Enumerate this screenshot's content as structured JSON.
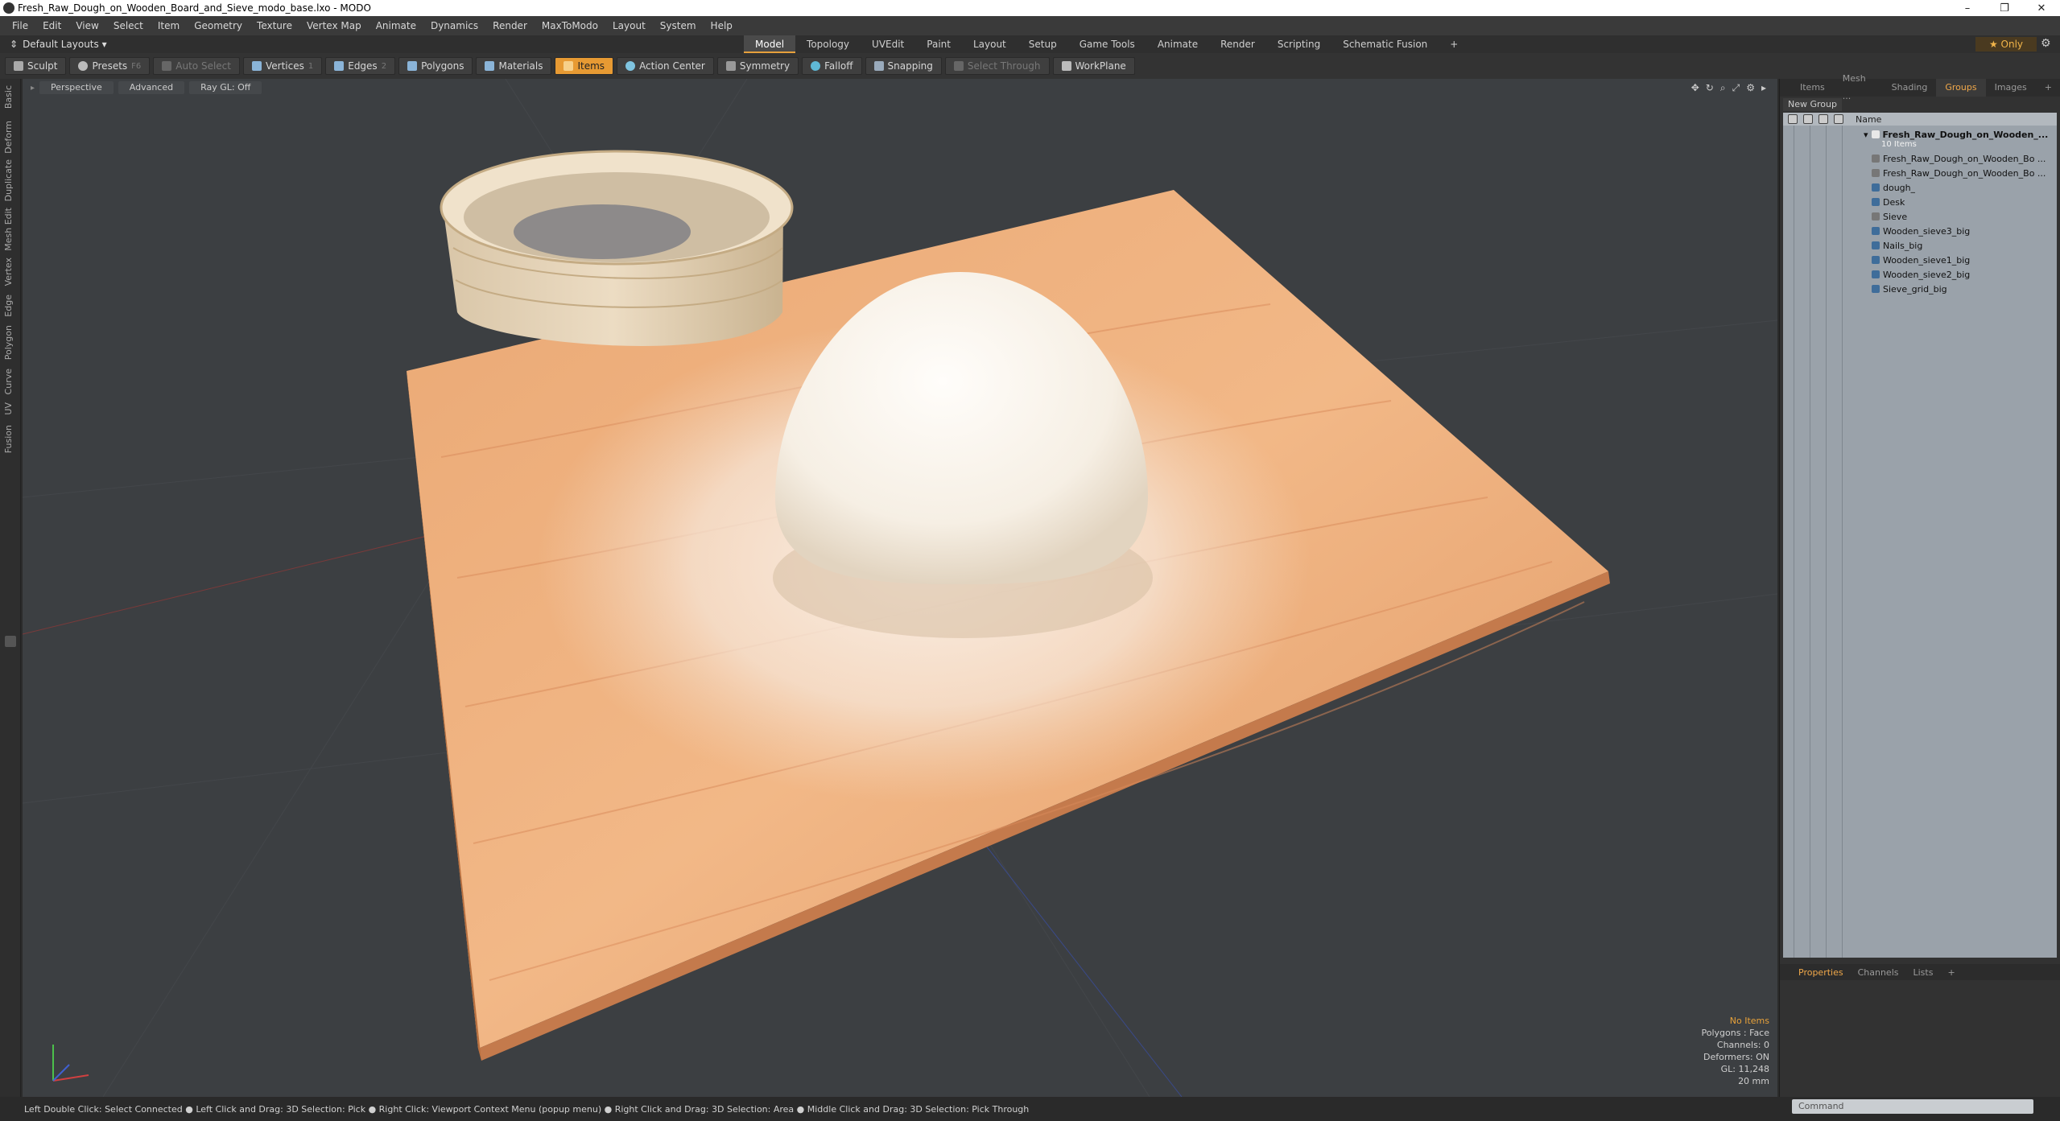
{
  "window": {
    "title": "Fresh_Raw_Dough_on_Wooden_Board_and_Sieve_modo_base.lxo - MODO",
    "controls": [
      "–",
      "❐",
      "✕"
    ]
  },
  "menu": [
    "File",
    "Edit",
    "View",
    "Select",
    "Item",
    "Geometry",
    "Texture",
    "Vertex Map",
    "Animate",
    "Dynamics",
    "Render",
    "MaxToModo",
    "Layout",
    "System",
    "Help"
  ],
  "layoutbar": {
    "layouts_label": "Default Layouts ▾",
    "tabs": [
      "Model",
      "Topology",
      "UVEdit",
      "Paint",
      "Layout",
      "Setup",
      "Game Tools",
      "Animate",
      "Render",
      "Scripting",
      "Schematic Fusion",
      "+"
    ],
    "active_tab": "Model",
    "only_label": "★ Only"
  },
  "toolbar": [
    {
      "label": "Sculpt",
      "kb": ""
    },
    {
      "label": "Presets",
      "kb": "F6"
    },
    {
      "label": "Auto Select",
      "kb": ""
    },
    {
      "label": "Vertices",
      "kb": "1"
    },
    {
      "label": "Edges",
      "kb": "2"
    },
    {
      "label": "Polygons",
      "kb": ""
    },
    {
      "label": "Materials",
      "kb": ""
    },
    {
      "label": "Items",
      "kb": ""
    },
    {
      "label": "Action Center",
      "kb": ""
    },
    {
      "label": "Symmetry",
      "kb": ""
    },
    {
      "label": "Falloff",
      "kb": ""
    },
    {
      "label": "Snapping",
      "kb": ""
    },
    {
      "label": "Select Through",
      "kb": ""
    },
    {
      "label": "WorkPlane",
      "kb": ""
    }
  ],
  "left_tabs": [
    "Basic",
    "Deform",
    "Duplicate",
    "Mesh Edit",
    "Vertex",
    "Edge",
    "Polygon",
    "Curve",
    "UV",
    "Fusion"
  ],
  "viewport": {
    "view_mode": "Perspective",
    "shading": "Advanced",
    "raygl": "Ray GL: Off",
    "hud": {
      "selection": "No Items",
      "polygons": "Polygons : Face",
      "channels": "Channels: 0",
      "deformers": "Deformers: ON",
      "gl": "GL: 11,248",
      "scale": "20 mm"
    }
  },
  "right_panel": {
    "tabs": [
      "Items",
      "Mesh ...",
      "Shading",
      "Groups",
      "Images",
      "+"
    ],
    "active_tab": "Groups",
    "new_group": "New Group",
    "column_name": "Name",
    "tree": [
      {
        "label": "Fresh_Raw_Dough_on_Wooden_...",
        "indent": 0,
        "root": true
      },
      {
        "label": "10 Items",
        "indent": 1,
        "sub": true
      },
      {
        "label": "Fresh_Raw_Dough_on_Wooden_Bo ...",
        "indent": 1
      },
      {
        "label": "Fresh_Raw_Dough_on_Wooden_Bo ...",
        "indent": 1
      },
      {
        "label": "dough_",
        "indent": 1
      },
      {
        "label": "Desk",
        "indent": 1
      },
      {
        "label": "Sieve",
        "indent": 1
      },
      {
        "label": "Wooden_sieve3_big",
        "indent": 1
      },
      {
        "label": "Nails_big",
        "indent": 1
      },
      {
        "label": "Wooden_sieve1_big",
        "indent": 1
      },
      {
        "label": "Wooden_sieve2_big",
        "indent": 1
      },
      {
        "label": "Sieve_grid_big",
        "indent": 1
      }
    ],
    "bottom_tabs": [
      "Properties",
      "Channels",
      "Lists",
      "+"
    ],
    "bottom_active": "Properties"
  },
  "statusbar": "Left Double Click: Select Connected ● Left Click and Drag: 3D Selection: Pick ● Right Click: Viewport Context Menu (popup menu) ● Right Click and Drag: 3D Selection: Area ● Middle Click and Drag: 3D Selection: Pick Through",
  "command_placeholder": "Command"
}
